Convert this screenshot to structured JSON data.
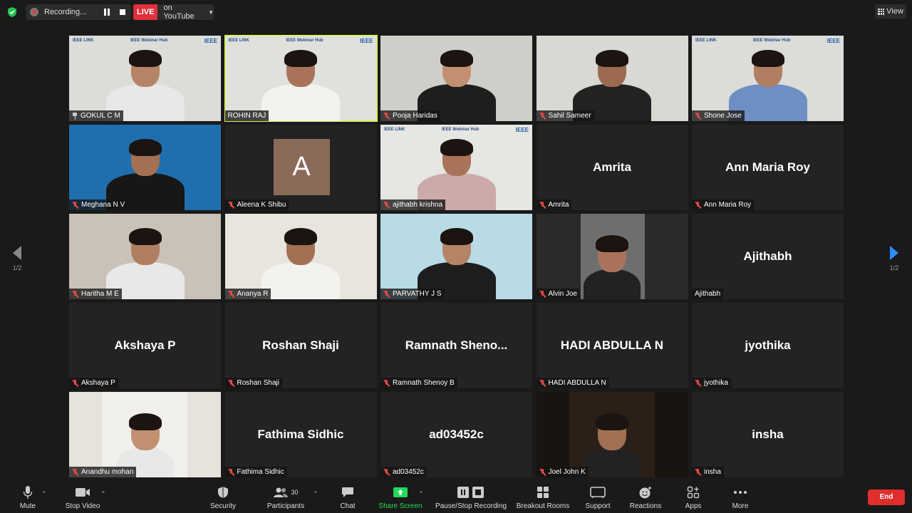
{
  "top_bar": {
    "recording_label": "Recording...",
    "live_label": "LIVE",
    "stream_target": "on YouTube",
    "view_label": "View"
  },
  "pagination": {
    "left_page": "1/2",
    "right_page": "1/2"
  },
  "colors": {
    "live_red": "#e0303a",
    "mute_red": "#e54848",
    "active_speaker": "#d6f264",
    "share_green": "#23d959",
    "end_red": "#e02e2e",
    "page_arrow_blue": "#2d8cff"
  },
  "participants": [
    {
      "name": "GOKUL C M",
      "display": "",
      "icon": "pin-icon",
      "video": true,
      "banner": true
    },
    {
      "name": "ROHIN RAJ",
      "display": "",
      "icon": "",
      "video": true,
      "banner": true,
      "active": true
    },
    {
      "name": "Pooja Haridas",
      "display": "",
      "icon": "muted-mic-icon",
      "video": true,
      "banner": false
    },
    {
      "name": "Sahil Sameer",
      "display": "",
      "icon": "muted-mic-icon",
      "video": true,
      "banner": false
    },
    {
      "name": "Shone Jose",
      "display": "",
      "icon": "muted-mic-icon",
      "video": true,
      "banner": true
    },
    {
      "name": "Meghana N V",
      "display": "",
      "icon": "muted-mic-icon",
      "video": true,
      "banner": false
    },
    {
      "name": "Aleena K Shibu",
      "display": "",
      "icon": "muted-mic-icon",
      "video": false,
      "avatar_letter": "A"
    },
    {
      "name": "ajithabh krishna",
      "display": "",
      "icon": "muted-mic-icon",
      "video": true,
      "banner": true
    },
    {
      "name": "Amrita",
      "display": "Amrita",
      "icon": "muted-mic-icon",
      "video": false
    },
    {
      "name": "Ann Maria Roy",
      "display": "Ann Maria Roy",
      "icon": "muted-mic-icon",
      "video": false
    },
    {
      "name": "Haritha M E",
      "display": "",
      "icon": "muted-mic-icon",
      "video": true,
      "banner": false
    },
    {
      "name": "Ananya R",
      "display": "",
      "icon": "muted-mic-icon",
      "video": true,
      "banner": false
    },
    {
      "name": "PARVATHY J S",
      "display": "",
      "icon": "muted-mic-icon",
      "video": true,
      "banner": false
    },
    {
      "name": "Alvin Joe",
      "display": "",
      "icon": "muted-mic-icon",
      "video": true,
      "banner": false
    },
    {
      "name": "Ajithabh",
      "display": "Ajithabh",
      "icon": "",
      "video": false
    },
    {
      "name": "Akshaya P",
      "display": "Akshaya P",
      "icon": "muted-mic-icon",
      "video": false
    },
    {
      "name": "Roshan Shaji",
      "display": "Roshan Shaji",
      "icon": "muted-mic-icon",
      "video": false
    },
    {
      "name": "Ramnath Shenoy B",
      "display": "Ramnath  Sheno...",
      "icon": "muted-mic-icon",
      "video": false
    },
    {
      "name": "HADI ABDULLA N",
      "display": "HADI ABDULLA N",
      "icon": "muted-mic-icon",
      "video": false
    },
    {
      "name": "jyothika",
      "display": "jyothika",
      "icon": "muted-mic-icon",
      "video": false
    },
    {
      "name": "Anandhu mohan",
      "display": "",
      "icon": "muted-mic-icon",
      "video": true,
      "banner": false
    },
    {
      "name": "Fathima Sidhic",
      "display": "Fathima Sidhic",
      "icon": "muted-mic-icon",
      "video": false
    },
    {
      "name": "ad03452c",
      "display": "ad03452c",
      "icon": "muted-mic-icon",
      "video": false
    },
    {
      "name": "Joel John K",
      "display": "",
      "icon": "muted-mic-icon",
      "video": true,
      "banner": false
    },
    {
      "name": "insha",
      "display": "insha",
      "icon": "muted-mic-icon",
      "video": false
    }
  ],
  "banner": {
    "left": "IEEE LINK",
    "center": "IEEE Webinar Hub",
    "right": "IEEE"
  },
  "toolbar": {
    "mute": "Mute",
    "stop_video": "Stop Video",
    "security": "Security",
    "participants": "Participants",
    "participants_count": "30",
    "chat": "Chat",
    "share_screen": "Share Screen",
    "pause_stop_recording": "Pause/Stop Recording",
    "breakout_rooms": "Breakout Rooms",
    "support": "Support",
    "reactions": "Reactions",
    "apps": "Apps",
    "more": "More",
    "end": "End"
  }
}
